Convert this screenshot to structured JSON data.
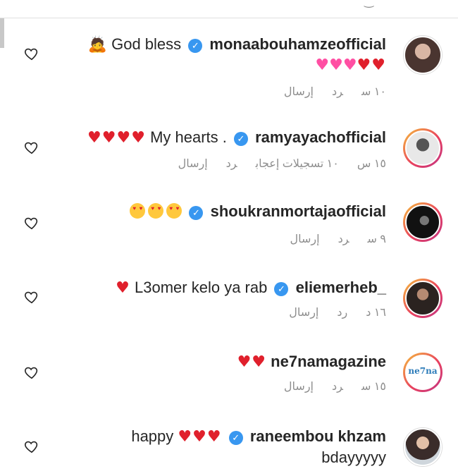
{
  "comments": [
    {
      "username": "monaabouhamzeofficial",
      "text": "God bless",
      "emoji_prefix": "🙏",
      "emoji_line2": "💗💗💗❤️❤️",
      "time": "١٠ س",
      "reply": "رد",
      "send": "إرسال",
      "verified": true
    },
    {
      "username": "ramyayachofficial",
      "text": "My hearts .",
      "emoji_suffix": "❤️❤️❤️❤️",
      "time": "١٥ س",
      "likes": "١٠ تسجيلات إعجاب",
      "reply": "رد",
      "send": "إرسال",
      "verified": true
    },
    {
      "username": "shoukranmortajaofficial",
      "text": "",
      "emoji_suffix": "😍😍😍",
      "time": "٩ س",
      "reply": "رد",
      "send": "إرسال",
      "verified": true
    },
    {
      "username": "eliemerheb_",
      "text": "L3omer kelo ya rab",
      "emoji_suffix": "❤️",
      "time": "١٦ د",
      "reply": "رد",
      "send": "إرسال",
      "verified": true
    },
    {
      "username": "ne7namagazine",
      "text": "",
      "emoji_suffix": "❤️❤️",
      "time": "١٥ س",
      "reply": "رد",
      "send": "إرسال",
      "verified": false,
      "avatar_text": "ne7na"
    },
    {
      "username": "raneembou khzam",
      "text": "happy",
      "emoji_suffix": "❤️❤️❤️",
      "line2": "bdayyyyy",
      "verified": true
    }
  ],
  "colors": {
    "verified": "#3897f0",
    "meta_text": "#8e8e8e",
    "heart": "#e0202c"
  }
}
